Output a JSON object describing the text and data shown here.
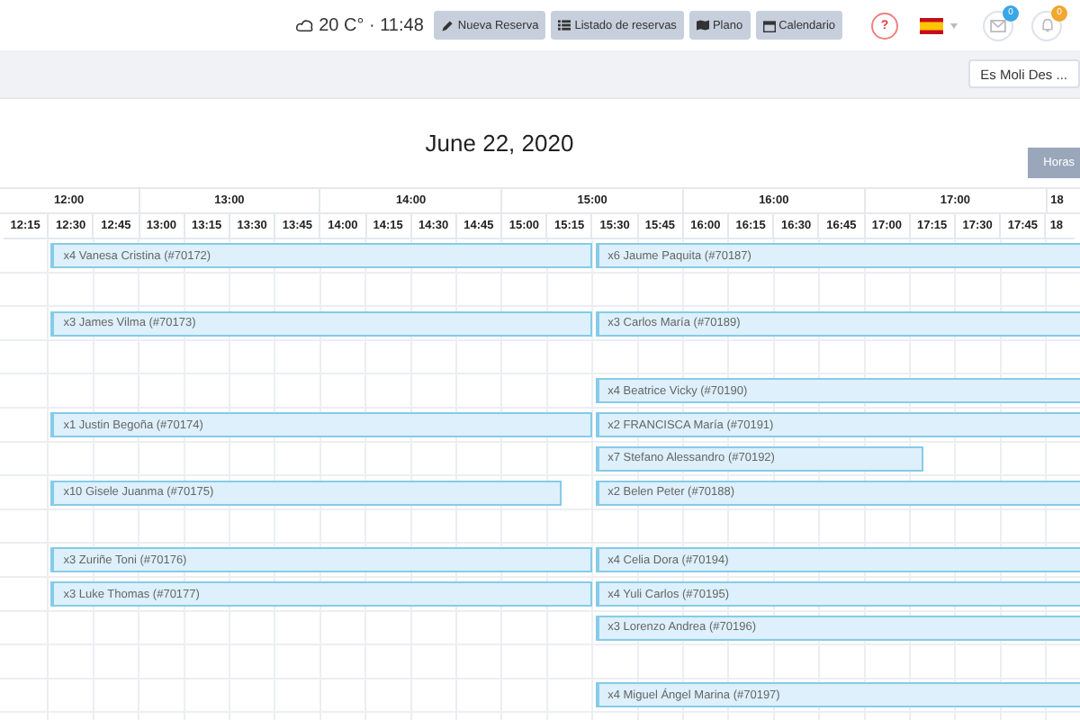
{
  "top_bar": {
    "weather": "20 C° · 11:48",
    "buttons": [
      {
        "kind": "pencil",
        "label": "Nueva Reserva"
      },
      {
        "kind": "list",
        "label": "Listado de reservas"
      },
      {
        "kind": "map",
        "label": "Plano"
      },
      {
        "kind": "calendar",
        "label": "Calendario"
      }
    ],
    "help": "?",
    "notifications": [
      {
        "kind": "mail",
        "badge": "0",
        "color": "#3aa6e8"
      },
      {
        "kind": "bell",
        "badge": "0",
        "color": "#f0a830"
      }
    ]
  },
  "sub_bar": {
    "restaurant": "Es Moli Des ..."
  },
  "calendar": {
    "date": "June 22, 2020",
    "hours_button": "Horas",
    "hours": [
      "12:00",
      "13:00",
      "14:00",
      "15:00",
      "16:00",
      "17:00",
      "18"
    ],
    "slots": [
      "12:15",
      "12:30",
      "12:45",
      "13:00",
      "13:15",
      "13:30",
      "13:45",
      "14:00",
      "14:15",
      "14:30",
      "14:45",
      "15:00",
      "15:15",
      "15:30",
      "15:45",
      "16:00",
      "16:15",
      "16:30",
      "16:45",
      "17:00",
      "17:15",
      "17:30",
      "17:45",
      "18"
    ],
    "rows": [
      {
        "bookings": [
          {
            "kind": "early",
            "label": "x4 Vanesa Cristina (#70172)"
          },
          {
            "kind": "late",
            "label": "x6 Jaume Paquita (#70187)"
          }
        ]
      },
      {
        "bookings": []
      },
      {
        "bookings": [
          {
            "kind": "early",
            "label": "x3 James Vilma (#70173)"
          },
          {
            "kind": "late",
            "label": "x3 Carlos María (#70189)"
          }
        ]
      },
      {
        "bookings": []
      },
      {
        "bookings": [
          {
            "kind": "late",
            "label": "x4 Beatrice Vicky (#70190)"
          }
        ]
      },
      {
        "bookings": [
          {
            "kind": "early",
            "label": "x1 Justin Begoña (#70174)"
          },
          {
            "kind": "late",
            "label": "x2 FRANCISCA María (#70191)"
          }
        ]
      },
      {
        "bookings": [
          {
            "kind": "lateshort",
            "label": "x7 Stefano Alessandro (#70192)"
          }
        ]
      },
      {
        "bookings": [
          {
            "kind": "earlyshort",
            "label": "x10 Gisele Juanma (#70175)"
          },
          {
            "kind": "late",
            "label": "x2 Belen Peter (#70188)"
          }
        ]
      },
      {
        "bookings": []
      },
      {
        "bookings": [
          {
            "kind": "early",
            "label": "x3 Zuriñe Toni (#70176)"
          },
          {
            "kind": "late",
            "label": "x4 Celia Dora (#70194)"
          }
        ]
      },
      {
        "bookings": [
          {
            "kind": "early",
            "label": "x3 Luke Thomas (#70177)"
          },
          {
            "kind": "late",
            "label": "x4 Yuli Carlos (#70195)"
          }
        ]
      },
      {
        "bookings": [
          {
            "kind": "late",
            "label": "x3 Lorenzo Andrea (#70196)"
          }
        ]
      },
      {
        "bookings": []
      },
      {
        "bookings": [
          {
            "kind": "late",
            "label": "x4 Miguel Ángel Marina (#70197)"
          }
        ]
      }
    ]
  }
}
